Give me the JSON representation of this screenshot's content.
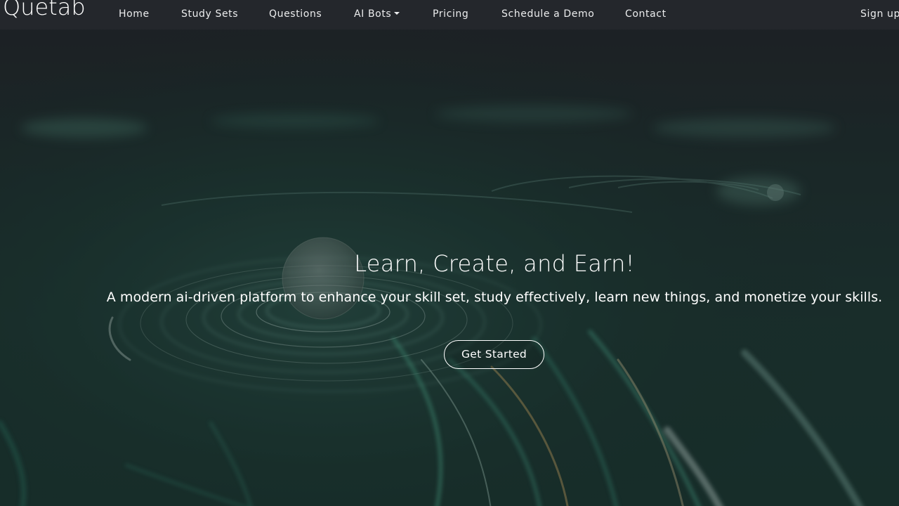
{
  "brand": {
    "logo_text": "Quetab"
  },
  "nav": {
    "items": [
      {
        "label": "Home"
      },
      {
        "label": "Study Sets"
      },
      {
        "label": "Questions"
      },
      {
        "label": "AI Bots",
        "has_dropdown": true
      },
      {
        "label": "Pricing"
      },
      {
        "label": "Schedule a Demo"
      },
      {
        "label": "Contact"
      }
    ],
    "signup_label": "Sign up"
  },
  "hero": {
    "title": "Learn, Create, and Earn!",
    "subtitle": "A modern ai-driven platform to enhance your skill set, study effectively, learn new things, and monetize your skills.",
    "cta_label": "Get Started",
    "background_image": "swirling light trails around a glowing sphere"
  },
  "colors": {
    "navbar_bg": "#24272c",
    "hero_bg_top": "#23282c",
    "hero_bg_bottom": "#1a3b33",
    "accent_trails": "#3fbf9a",
    "text": "#ffffff"
  }
}
